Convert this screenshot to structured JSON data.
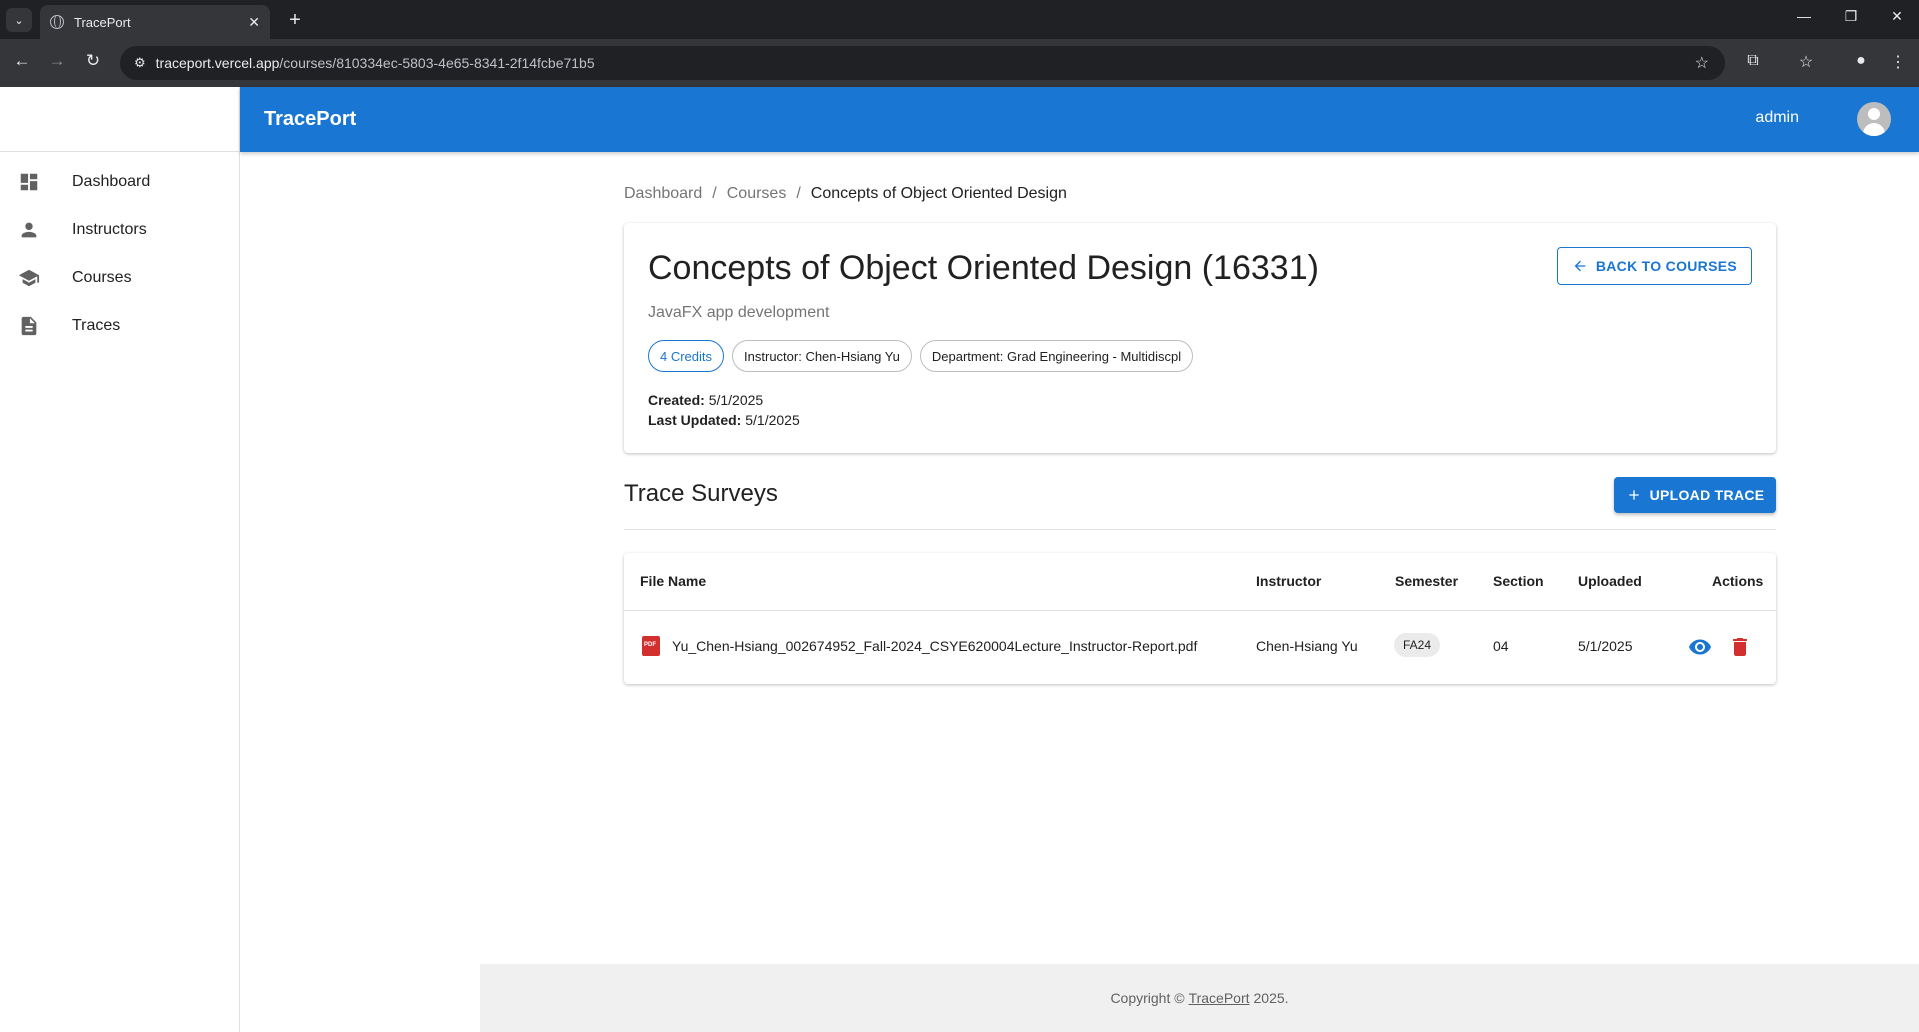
{
  "browser": {
    "tab_title": "TracePort",
    "url_host": "traceport.vercel.app",
    "url_path": "/courses/810334ec-5803-4e65-8341-2f14fcbe71b5"
  },
  "app": {
    "brand": "TracePort",
    "user": "admin",
    "accent_color": "#1976d2"
  },
  "sidebar": {
    "items": [
      {
        "label": "Dashboard",
        "icon": "dashboard-icon"
      },
      {
        "label": "Instructors",
        "icon": "person-icon"
      },
      {
        "label": "Courses",
        "icon": "school-icon"
      },
      {
        "label": "Traces",
        "icon": "document-icon"
      }
    ]
  },
  "breadcrumb": {
    "items": [
      "Dashboard",
      "Courses"
    ],
    "current": "Concepts of Object Oriented Design",
    "separator": "/"
  },
  "course": {
    "title": "Concepts of Object Oriented Design (16331)",
    "description": "JavaFX app development",
    "chips": [
      "4 Credits",
      "Instructor: Chen-Hsiang Yu",
      "Department: Grad Engineering - Multidiscpl"
    ],
    "created_label": "Created:",
    "created_value": "5/1/2025",
    "updated_label": "Last Updated:",
    "updated_value": "5/1/2025",
    "back_button": "BACK TO COURSES"
  },
  "traces": {
    "section_title": "Trace Surveys",
    "upload_button": "UPLOAD TRACE",
    "columns": [
      "File Name",
      "Instructor",
      "Semester",
      "Section",
      "Uploaded",
      "Actions"
    ],
    "rows": [
      {
        "file_name": "Yu_Chen-Hsiang_002674952_Fall-2024_CSYE620004Lecture_Instructor-Report.pdf",
        "instructor": "Chen-Hsiang Yu",
        "semester": "FA24",
        "section": "04",
        "uploaded": "5/1/2025"
      }
    ]
  },
  "footer": {
    "prefix": "Copyright ©",
    "link": "TracePort",
    "suffix": "2025."
  }
}
